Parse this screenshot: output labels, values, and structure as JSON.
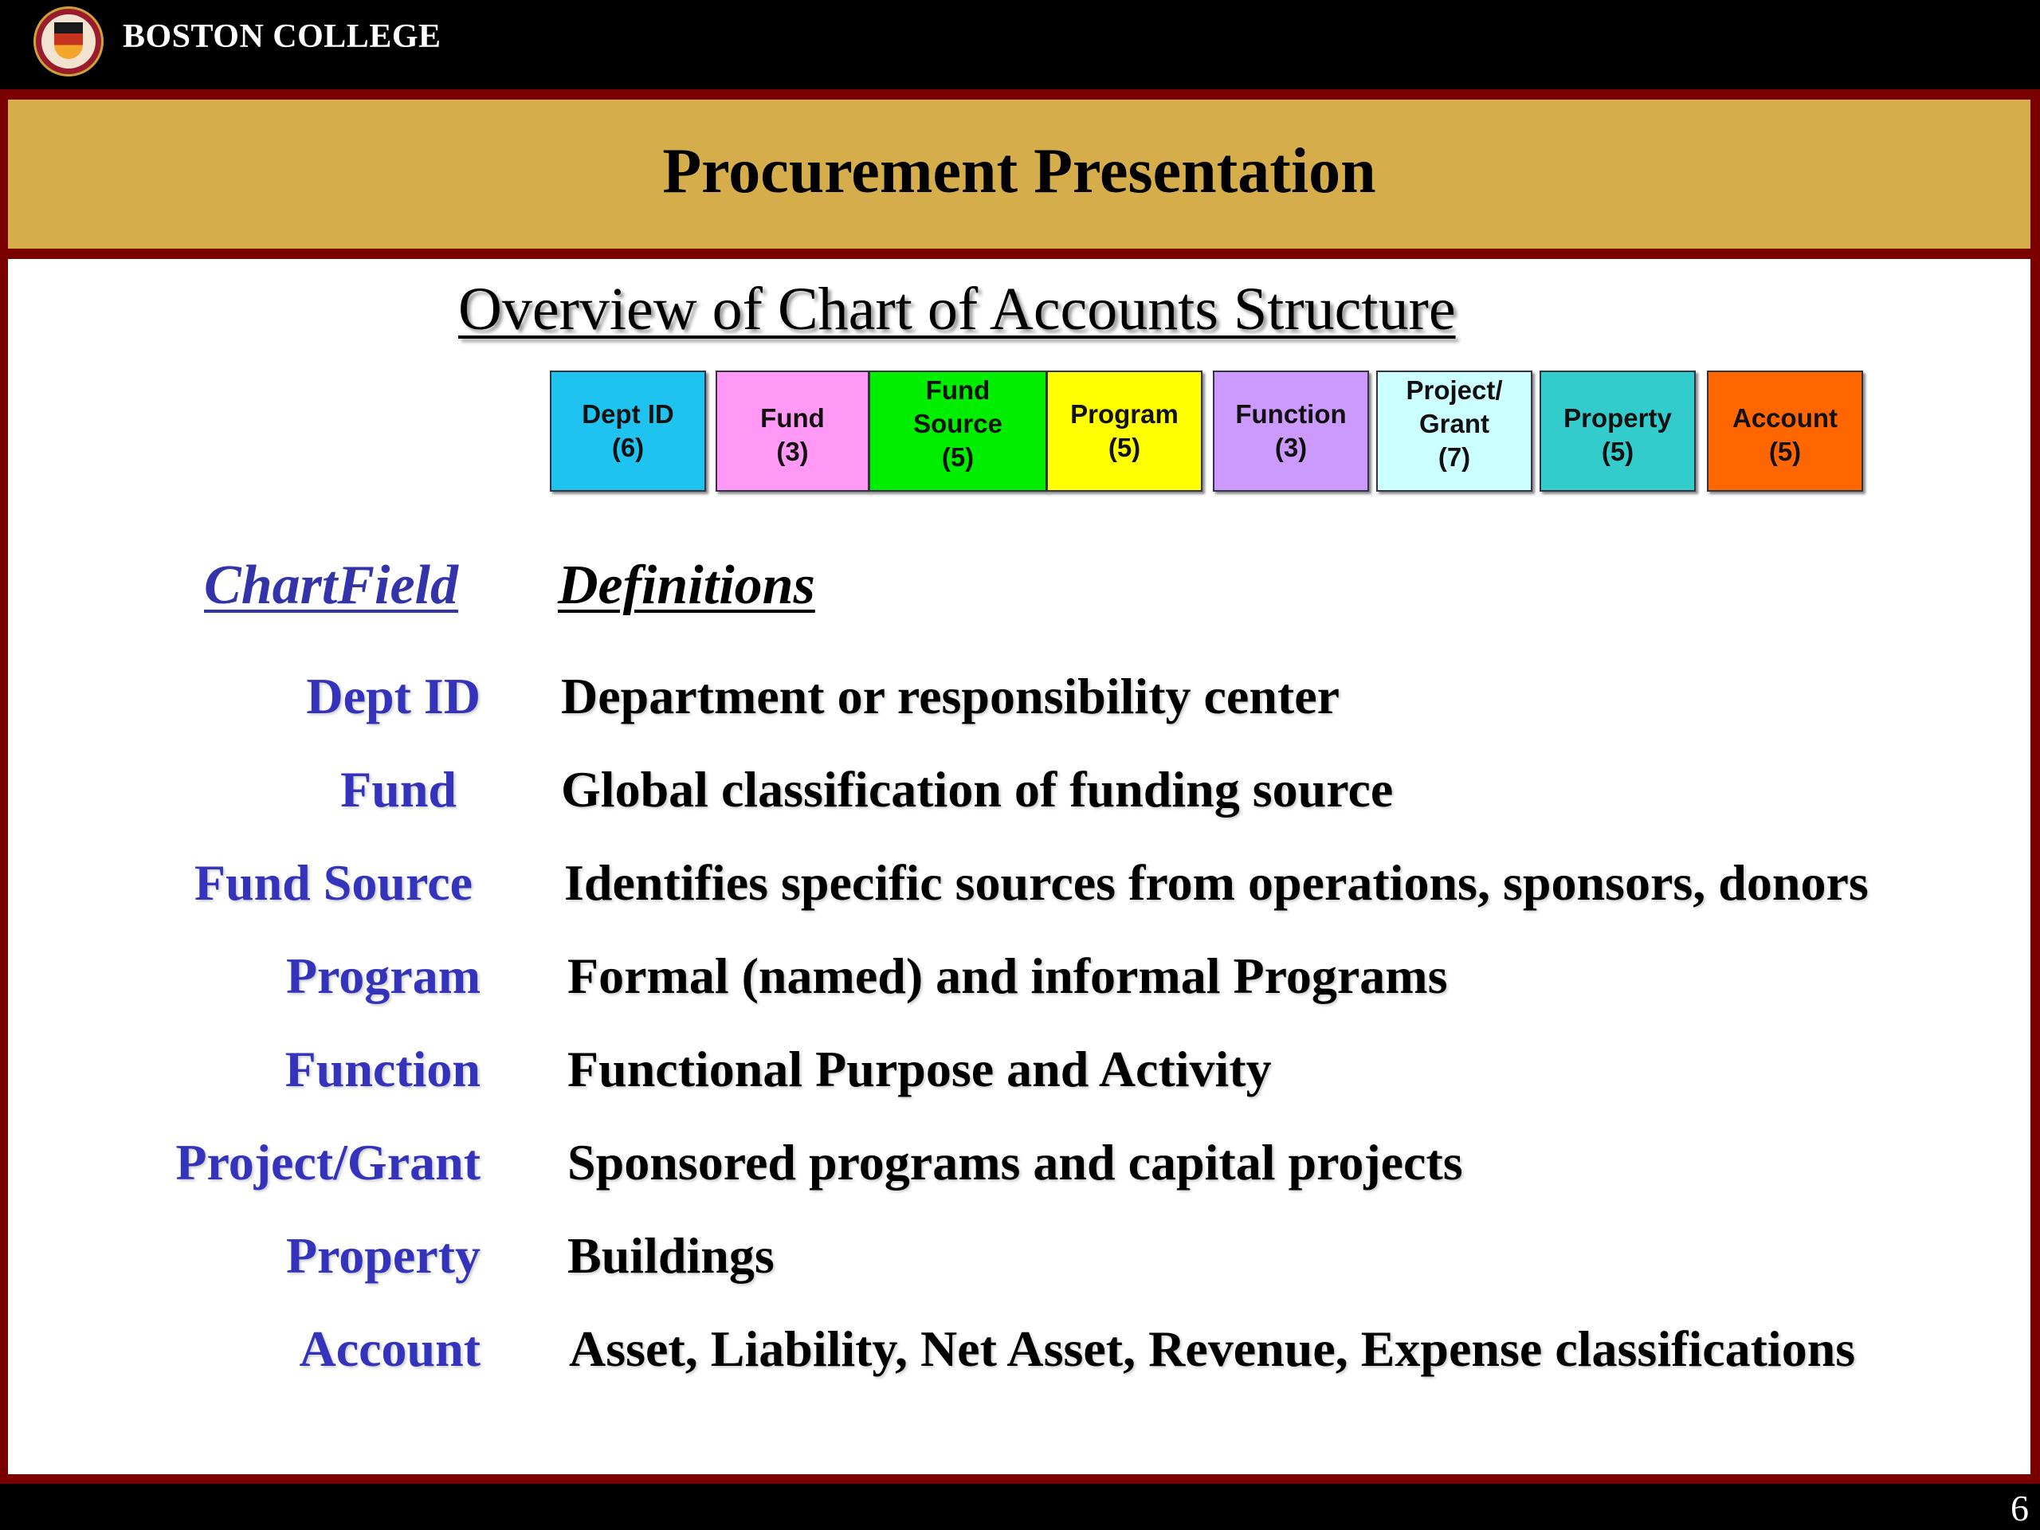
{
  "header": {
    "brand": "BOSTON COLLEGE",
    "logo_icon": "boston-college-seal-icon"
  },
  "banner": {
    "title": "Procurement Presentation"
  },
  "slide": {
    "title": "Overview of Chart of Accounts Structure",
    "structure_boxes": [
      {
        "line1": "Dept ID",
        "line2": "(6)",
        "color": "#1fc3f0"
      },
      {
        "line1": "Fund",
        "line2": "(3)",
        "color": "#ff99f5"
      },
      {
        "line1": "Fund",
        "line2": "Source",
        "line3": "(5)",
        "color": "#00ee00"
      },
      {
        "line1": "Program",
        "line2": "(5)",
        "color": "#ffff00"
      },
      {
        "line1": "Function",
        "line2": "(3)",
        "color": "#cc99ff"
      },
      {
        "line1": "Project/",
        "line2": "Grant",
        "line3": "(7)",
        "color": "#ccffff"
      },
      {
        "line1": "Property",
        "line2": "(5)",
        "color": "#33cccc"
      },
      {
        "line1": "Account",
        "line2": "(5)",
        "color": "#ff6600"
      }
    ],
    "column_headings": {
      "chartfield": "ChartField",
      "definitions": "Definitions"
    },
    "rows": [
      {
        "chartfield": "Dept ID",
        "definition": "Department or responsibility center"
      },
      {
        "chartfield": "Fund",
        "definition": "Global classification of funding source"
      },
      {
        "chartfield": "Fund Source",
        "definition": "Identifies specific sources from operations, sponsors, donors"
      },
      {
        "chartfield": "Program",
        "definition": "Formal (named) and informal Programs"
      },
      {
        "chartfield": "Function",
        "definition": "Functional Purpose and Activity"
      },
      {
        "chartfield": "Project/Grant",
        "definition": "Sponsored programs and capital projects"
      },
      {
        "chartfield": "Property",
        "definition": "Buildings"
      },
      {
        "chartfield": "Account",
        "definition": "Asset, Liability, Net Asset, Revenue, Expense classifications"
      }
    ]
  },
  "footer": {
    "page_number": "6"
  },
  "colors": {
    "maroon": "#7a0000",
    "gold": "#d5ae4b",
    "chartfield_blue": "#3333bb"
  }
}
